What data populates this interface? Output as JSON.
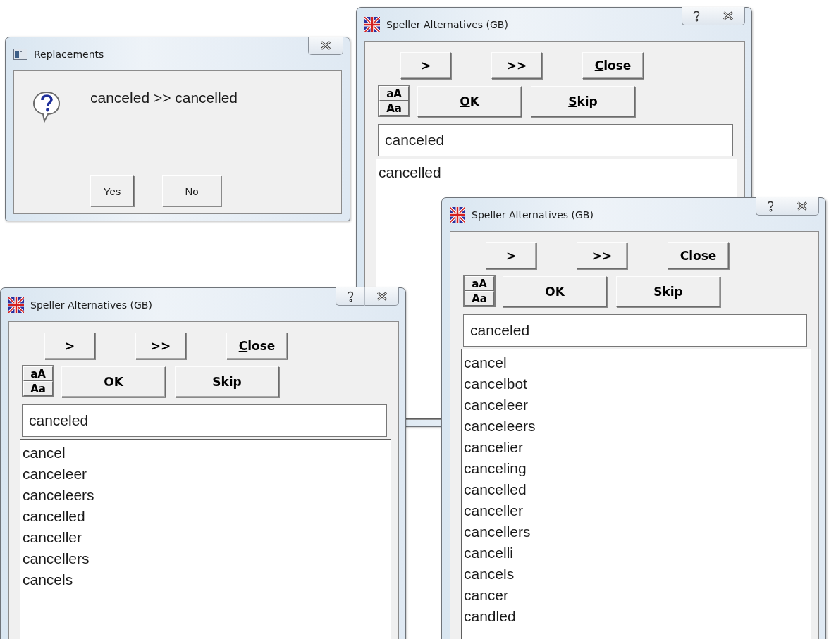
{
  "windows": [
    {
      "kind": "speller",
      "title": "Speller Alternatives (GB)",
      "nav_buttons": [
        {
          "label": ">",
          "mnemonic": false
        },
        {
          "label": ">>",
          "mnemonic": false
        },
        {
          "label": "Close",
          "mnemonic": true
        }
      ],
      "case_buttons": [
        "aA",
        "Aa"
      ],
      "action_buttons": [
        {
          "label": "OK",
          "mnemonic": true
        },
        {
          "label": "Skip",
          "mnemonic": true
        }
      ],
      "word": "canceled",
      "alternatives": [
        "cancelled"
      ]
    },
    {
      "kind": "message",
      "title": "Replacements",
      "message": "canceled >> cancelled",
      "buttons": [
        "Yes",
        "No"
      ]
    },
    {
      "kind": "speller",
      "title": "Speller Alternatives (GB)",
      "nav_buttons": [
        {
          "label": ">",
          "mnemonic": false
        },
        {
          "label": ">>",
          "mnemonic": false
        },
        {
          "label": "Close",
          "mnemonic": true
        }
      ],
      "case_buttons": [
        "aA",
        "Aa"
      ],
      "action_buttons": [
        {
          "label": "OK",
          "mnemonic": true
        },
        {
          "label": "Skip",
          "mnemonic": true
        }
      ],
      "word": "canceled",
      "alternatives": [
        "cancel",
        "canceleer",
        "canceleers",
        "cancelled",
        "canceller",
        "cancellers",
        "cancels"
      ]
    },
    {
      "kind": "speller",
      "title": "Speller Alternatives (GB)",
      "nav_buttons": [
        {
          "label": ">",
          "mnemonic": false
        },
        {
          "label": ">>",
          "mnemonic": false
        },
        {
          "label": "Close",
          "mnemonic": true
        }
      ],
      "case_buttons": [
        "aA",
        "Aa"
      ],
      "action_buttons": [
        {
          "label": "OK",
          "mnemonic": true
        },
        {
          "label": "Skip",
          "mnemonic": true
        }
      ],
      "word": "canceled",
      "alternatives": [
        "cancel",
        "cancelbot",
        "canceleer",
        "canceleers",
        "cancelier",
        "canceling",
        "cancelled",
        "canceller",
        "cancellers",
        "cancelli",
        "cancels",
        "cancer",
        "candled"
      ]
    }
  ]
}
